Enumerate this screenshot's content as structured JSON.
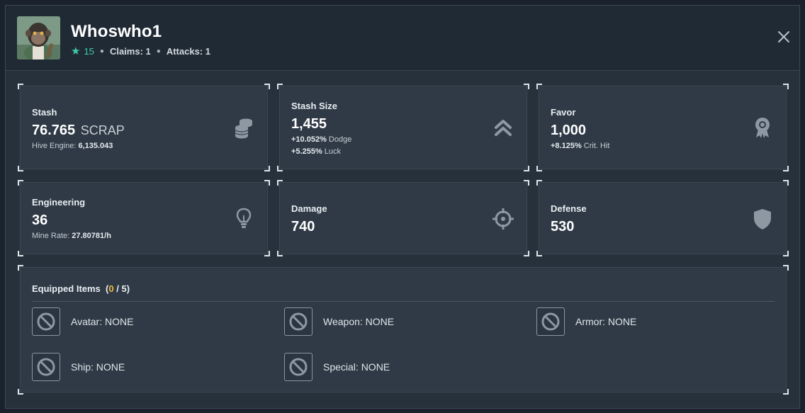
{
  "player": {
    "name": "Whoswho1",
    "level": "15",
    "claims_label": "Claims: 1",
    "attacks_label": "Attacks: 1"
  },
  "icons": {
    "star": "star-icon",
    "close": "close-icon",
    "stash": "coins-stack-icon",
    "stash_size": "double-chevron-up-icon",
    "favor": "award-ribbon-icon",
    "engineering": "lightbulb-icon",
    "damage": "crosshair-icon",
    "defense": "shield-icon",
    "empty_slot": "no-entry-icon"
  },
  "stats": {
    "stash": {
      "title": "Stash",
      "value": "76.765",
      "unit": "SCRAP",
      "sub_label": "Hive Engine:",
      "sub_value": "6,135.043"
    },
    "stash_size": {
      "title": "Stash Size",
      "value": "1,455",
      "dodge_value": "+10.052%",
      "dodge_label": "Dodge",
      "luck_value": "+5.255%",
      "luck_label": "Luck"
    },
    "favor": {
      "title": "Favor",
      "value": "1,000",
      "crit_value": "+8.125%",
      "crit_label": "Crit. Hit"
    },
    "engineering": {
      "title": "Engineering",
      "value": "36",
      "sub_label": "Mine Rate:",
      "sub_value": "27.80781/h"
    },
    "damage": {
      "title": "Damage",
      "value": "740"
    },
    "defense": {
      "title": "Defense",
      "value": "530"
    }
  },
  "equipment": {
    "title": "Equipped Items",
    "open_paren": "(",
    "count": "0",
    "total": "/ 5)",
    "slots": [
      {
        "label": "Avatar: NONE"
      },
      {
        "label": "Weapon: NONE"
      },
      {
        "label": "Armor: NONE"
      },
      {
        "label": "Ship: NONE"
      },
      {
        "label": "Special: NONE"
      }
    ]
  },
  "colors": {
    "accent_teal": "#3ecba8",
    "accent_orange": "#f6b93b",
    "card_bg": "#2f3a46",
    "modal_bg": "#26313c"
  }
}
